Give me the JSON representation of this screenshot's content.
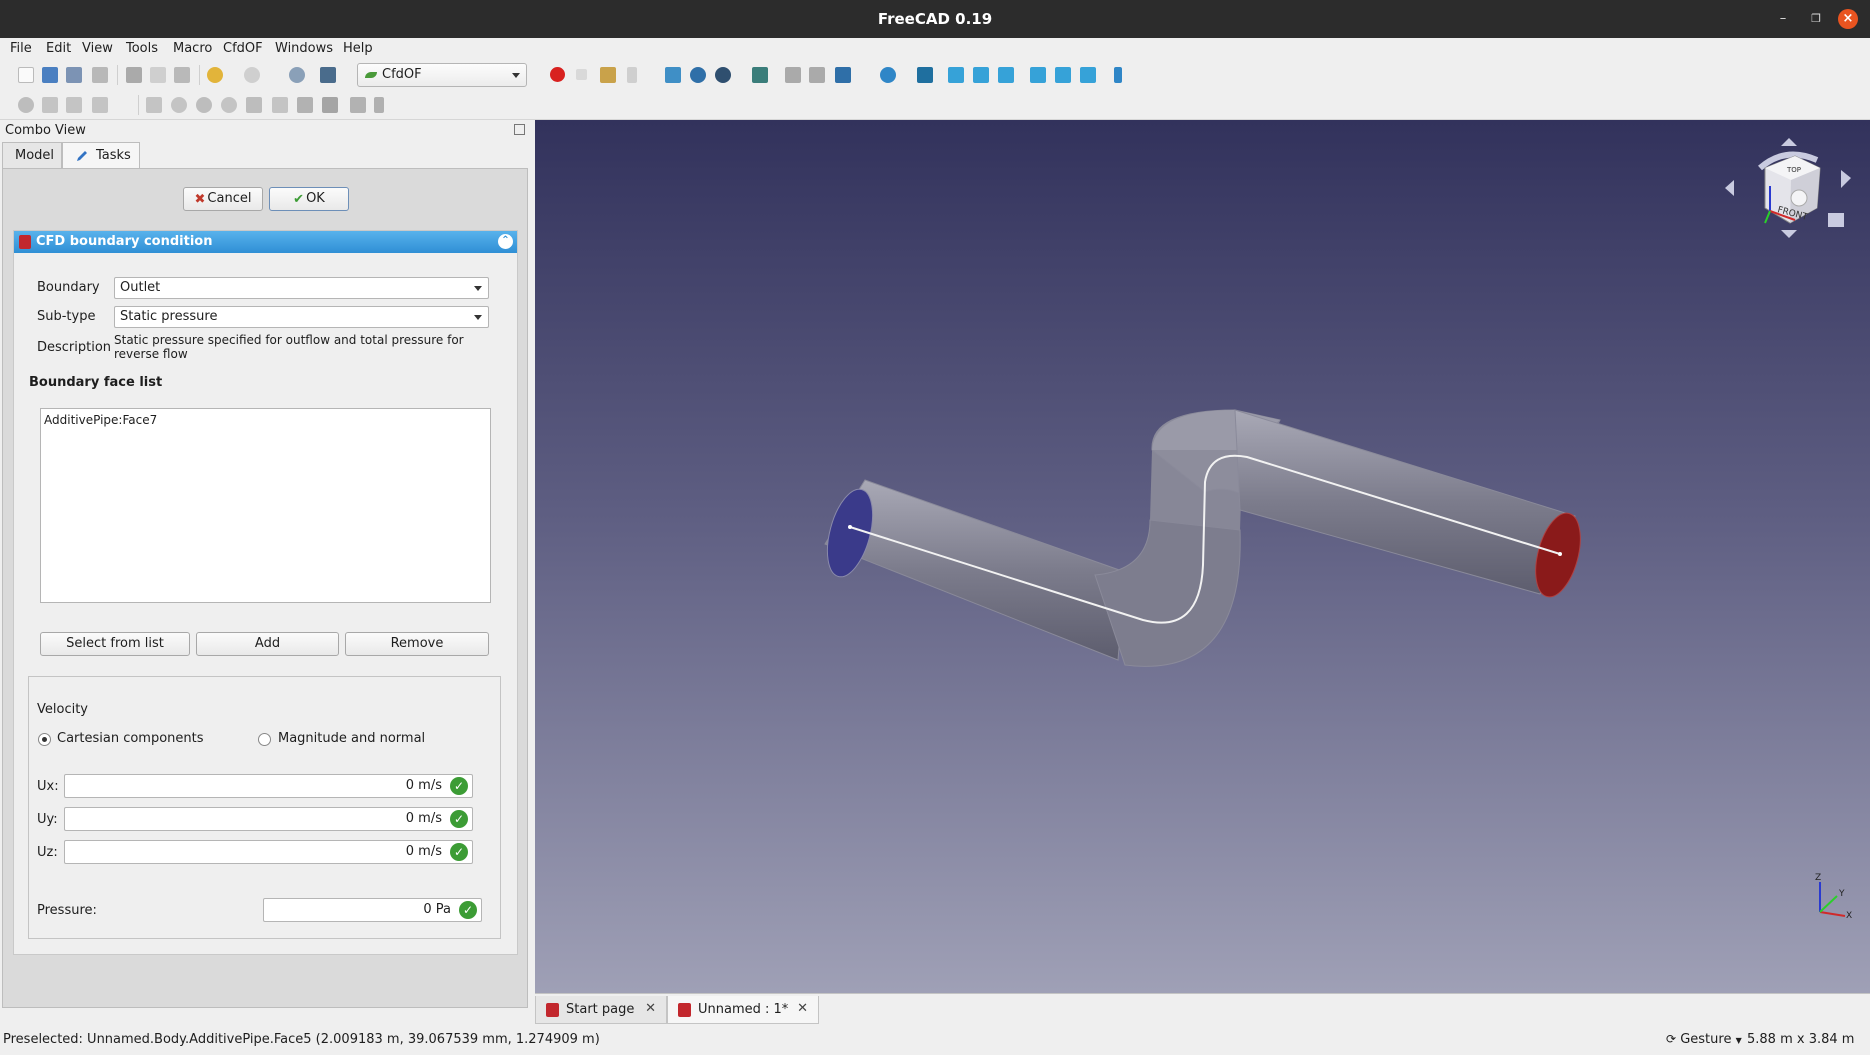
{
  "window": {
    "title": "FreeCAD 0.19"
  },
  "menu": [
    "File",
    "Edit",
    "View",
    "Tools",
    "Macro",
    "CfdOF",
    "Windows",
    "Help"
  ],
  "workbench": {
    "selected": "CfdOF"
  },
  "combo_view": {
    "title": "Combo View",
    "tabs": [
      "Model",
      "Tasks"
    ],
    "cancel_label": "Cancel",
    "ok_label": "OK"
  },
  "bc": {
    "header": "CFD boundary condition",
    "boundary_label": "Boundary",
    "boundary_value": "Outlet",
    "subtype_label": "Sub-type",
    "subtype_value": "Static pressure",
    "description_label": "Description",
    "description_value": "Static pressure specified for outflow and total pressure for reverse flow",
    "face_list_title": "Boundary face list",
    "faces": [
      "AdditivePipe:Face7"
    ],
    "select_from_list": "Select from list",
    "add": "Add",
    "remove": "Remove",
    "velocity_title": "Velocity",
    "cartesian_label": "Cartesian components",
    "magnitude_label": "Magnitude and normal",
    "ux_label": "Ux:",
    "ux_value": "0 m/s",
    "uy_label": "Uy:",
    "uy_value": "0 m/s",
    "uz_label": "Uz:",
    "uz_value": "0 m/s",
    "pressure_label": "Pressure:",
    "pressure_value": "0 Pa"
  },
  "navcube": {
    "front": "FRONT",
    "top": "TOP"
  },
  "axes": {
    "x": "X",
    "y": "Y",
    "z": "Z"
  },
  "doc_tabs": [
    {
      "label": "Start page"
    },
    {
      "label": "Unnamed : 1*"
    }
  ],
  "status": {
    "preselected": "Preselected: Unnamed.Body.AdditivePipe.Face5 (2.009183 m, 39.067539 mm, 1.274909 m)",
    "navigation": "Gesture",
    "dimensions": "5.88 m x 3.84 m"
  },
  "colors": {
    "view_top": "#32325c",
    "view_bottom": "#9fa0b6",
    "inlet_face": "#3a3a8a",
    "outlet_face": "#8a1a1a",
    "header_blue": "#2f8fd5",
    "check_green": "#3c9c35"
  }
}
